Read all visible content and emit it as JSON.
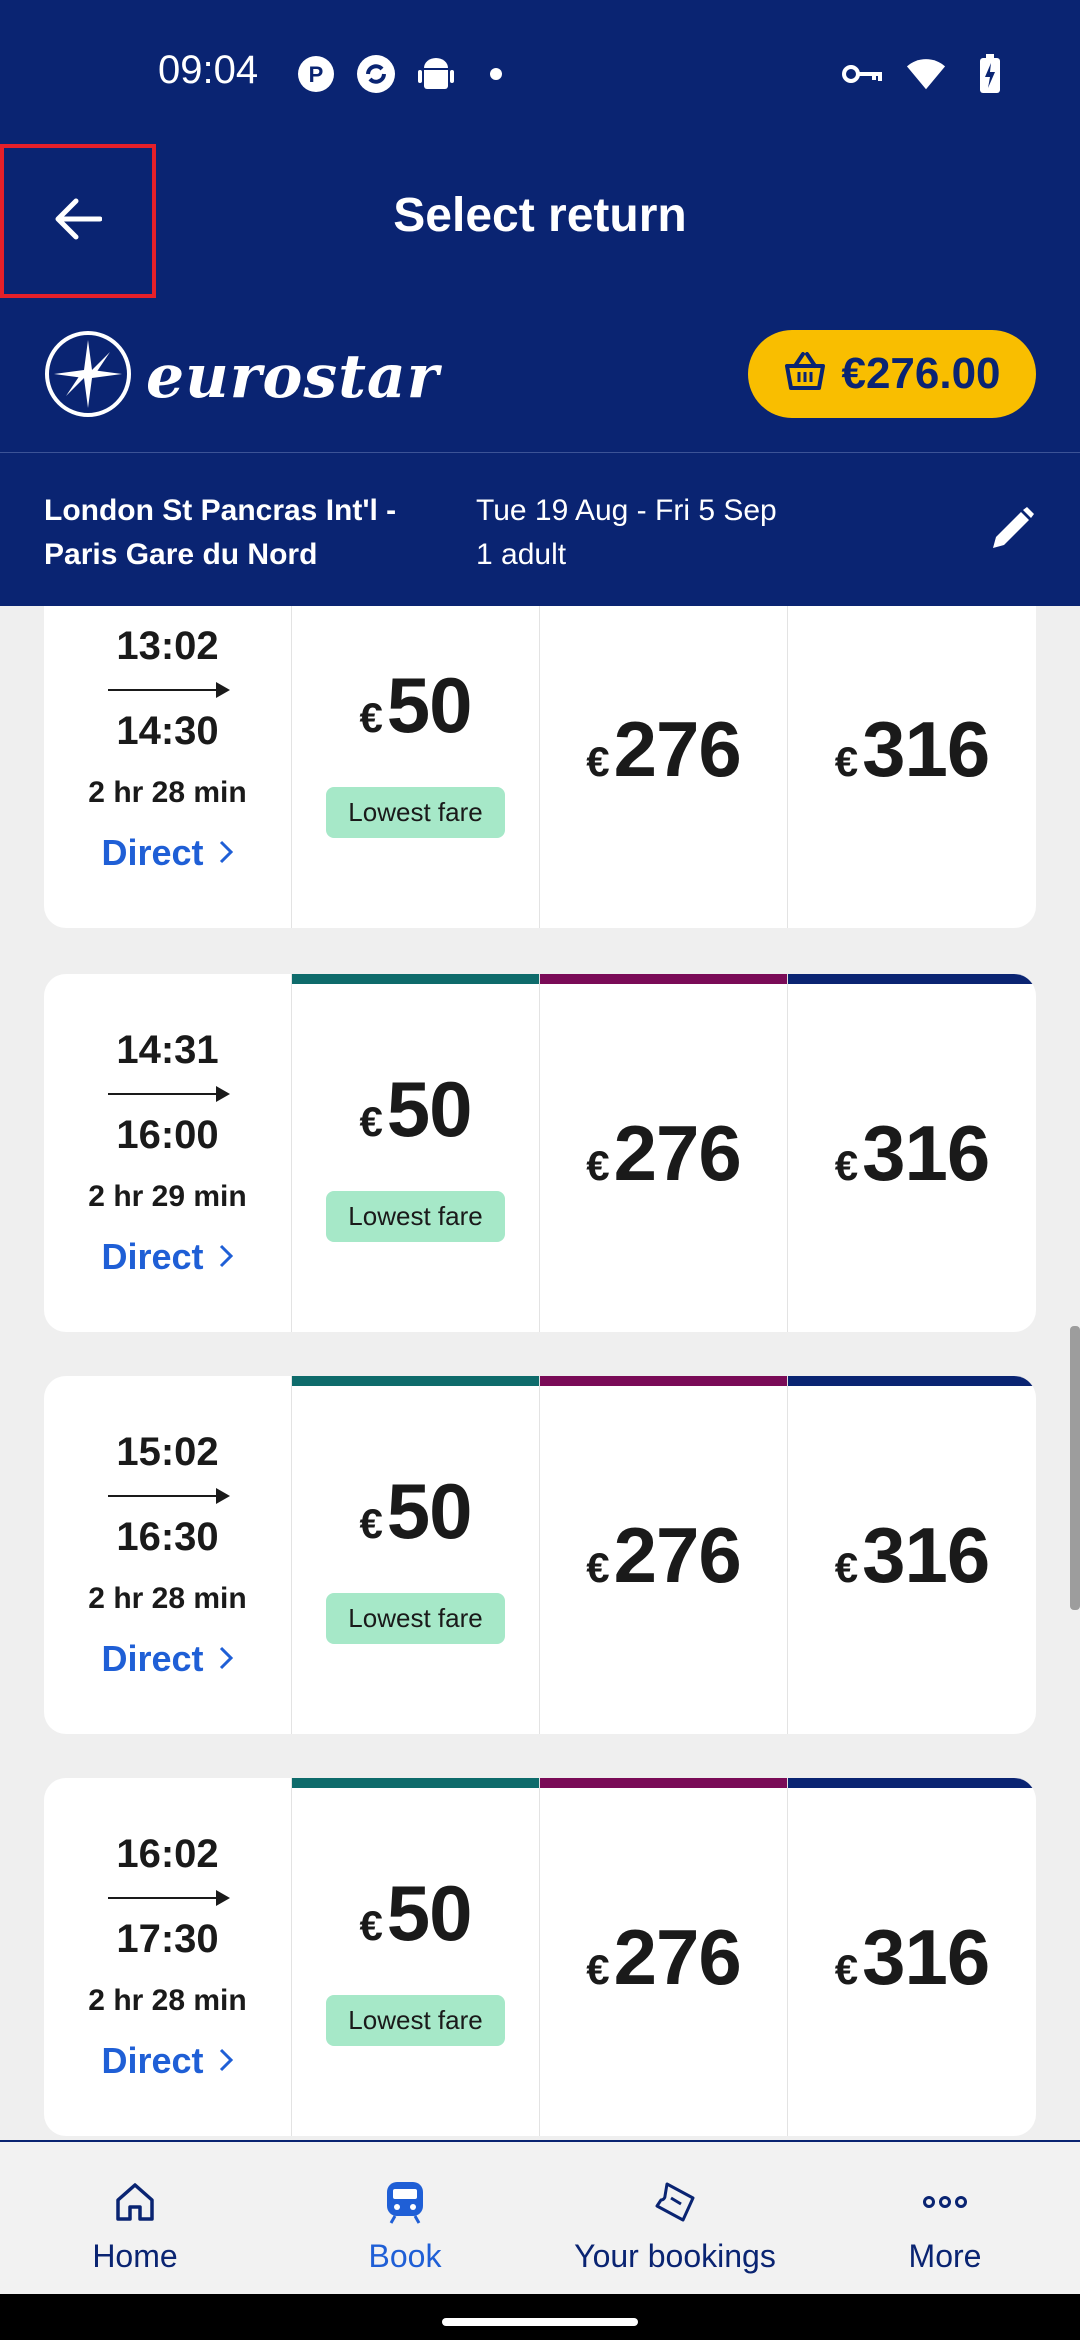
{
  "status_bar": {
    "time": "09:04"
  },
  "header": {
    "title": "Select return",
    "brand": "eurostar",
    "basket_total": "€276.00"
  },
  "journey": {
    "route_line1": "London St Pancras Int'l -",
    "route_line2": "Paris Gare du Nord",
    "dates": "Tue 19 Aug - Fri 5 Sep",
    "passengers": "1 adult"
  },
  "colors": {
    "header_bg": "#0a2472",
    "standard": "#0e6b6b",
    "plus": "#7a0b57",
    "premier": "#0a2472",
    "accent_yellow": "#f9be00",
    "lowest_fare_bg": "#a6e8c8",
    "link_blue": "#1f5fd6"
  },
  "currency": "€",
  "lowest_fare_label": "Lowest fare",
  "direct_label": "Direct",
  "trains": [
    {
      "depart": "13:02",
      "arrive": "14:30",
      "duration": "2 hr 28 min",
      "prices": [
        "50",
        "276",
        "316"
      ]
    },
    {
      "depart": "14:31",
      "arrive": "16:00",
      "duration": "2 hr 29 min",
      "prices": [
        "50",
        "276",
        "316"
      ]
    },
    {
      "depart": "15:02",
      "arrive": "16:30",
      "duration": "2 hr 28 min",
      "prices": [
        "50",
        "276",
        "316"
      ]
    },
    {
      "depart": "16:02",
      "arrive": "17:30",
      "duration": "2 hr 28 min",
      "prices": [
        "50",
        "276",
        "316"
      ]
    }
  ],
  "nav": {
    "home": "Home",
    "book": "Book",
    "bookings": "Your bookings",
    "more": "More"
  }
}
